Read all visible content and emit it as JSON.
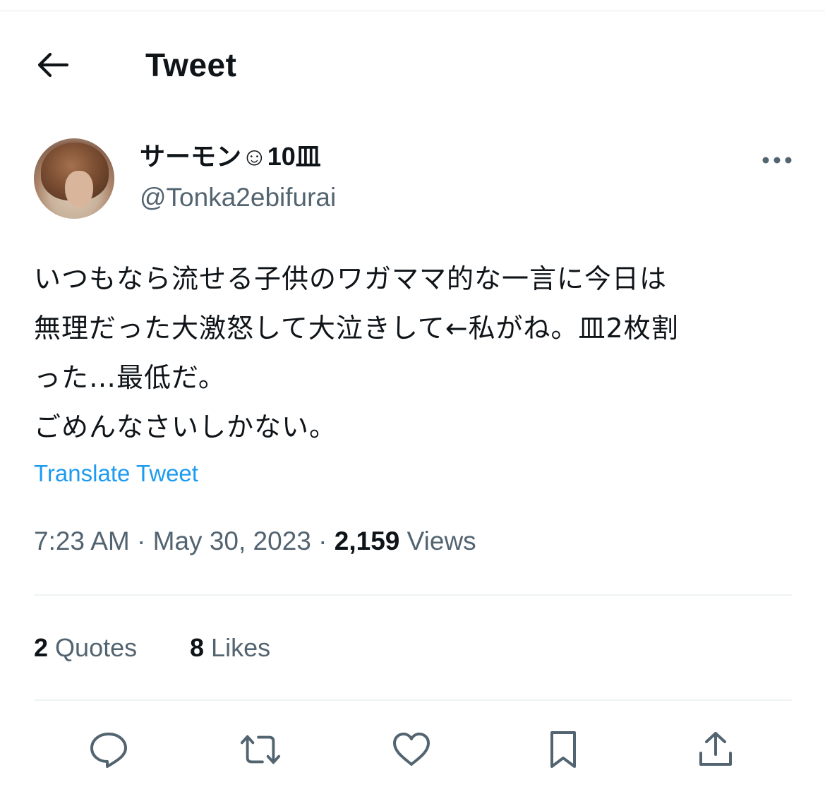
{
  "header": {
    "title": "Tweet",
    "back_icon": "arrow-left-icon"
  },
  "author": {
    "display_name": "サーモン☺10皿",
    "handle": "@Tonka2ebifurai",
    "more_icon": "more-horizontal-icon"
  },
  "tweet": {
    "lines": [
      "いつもなら流せる子供のワガママ的な一言に今日は",
      "無理だった大激怒して大泣きして←私がね。皿2枚割",
      "った…最低だ。",
      "ごめんなさいしかない。"
    ],
    "translate_label": "Translate Tweet",
    "time": "7:23 AM",
    "separator": "·",
    "date": "May 30, 2023",
    "views_count": "2,159",
    "views_label": "Views"
  },
  "stats": {
    "quotes_count": "2",
    "quotes_label": "Quotes",
    "likes_count": "8",
    "likes_label": "Likes"
  },
  "actions": {
    "icons": [
      "reply-icon",
      "retweet-icon",
      "like-icon",
      "bookmark-icon",
      "share-icon"
    ]
  },
  "colors": {
    "text": "#0f1419",
    "secondary": "#536471",
    "link": "#1d9bf0",
    "divider": "#eff3f4"
  }
}
